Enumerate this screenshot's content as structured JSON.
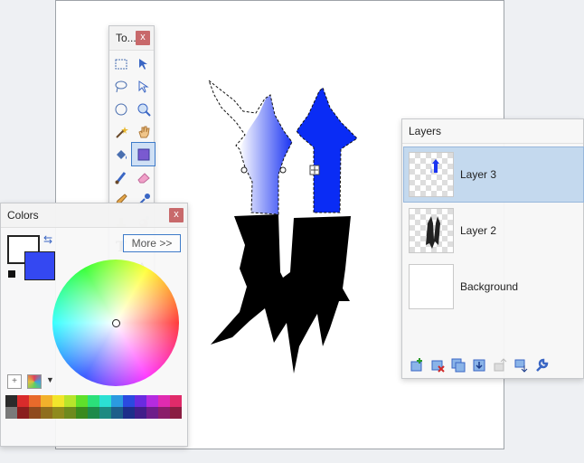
{
  "tools_window": {
    "title": "To...",
    "close_label": "x",
    "more_label": "More >>"
  },
  "colors_window": {
    "title": "Colors",
    "close_label": "x",
    "primary_color": "#ffffff",
    "secondary_color": "#3448f2",
    "palette": [
      "#2b2b2b",
      "#d92b2b",
      "#e86a2b",
      "#f2b12b",
      "#f2e52b",
      "#b8e52b",
      "#5fe02b",
      "#2be07a",
      "#2be0d4",
      "#2b9ae0",
      "#2b4ae0",
      "#6a2be0",
      "#b52be0",
      "#e02bb0",
      "#e02b6a",
      "#7a7a7a",
      "#8a1e1e",
      "#8f4a1e",
      "#8f6e1e",
      "#8f8a1e",
      "#6e8a1e",
      "#3a8a1e",
      "#1e8a4a",
      "#1e8a82",
      "#1e5e8a",
      "#1e2e8a",
      "#421e8a",
      "#6e1e8a",
      "#8a1e6a",
      "#8a1e42"
    ]
  },
  "layers_window": {
    "title": "Layers",
    "layers": [
      {
        "name": "Layer 3",
        "selected": true
      },
      {
        "name": "Layer 2",
        "selected": false
      },
      {
        "name": "Background",
        "selected": false
      }
    ]
  },
  "colors": {
    "accent_blue": "#0a2cf5",
    "selection_blue": "#c4d9ee"
  }
}
